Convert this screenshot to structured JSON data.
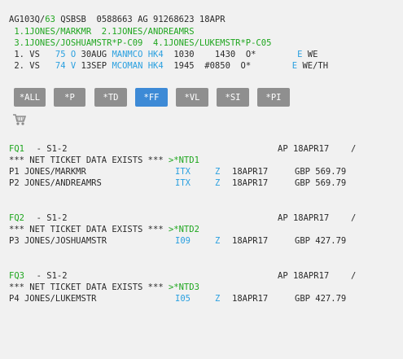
{
  "header": {
    "record_prefix": "AG103Q/",
    "record_num": "63",
    "record_rest": " QSBSB  0588663 AG 91268623 18APR"
  },
  "passengers_row1": " 1.1JONES/MARKMR  2.1JONES/ANDREAMRS",
  "passengers_row2": " 3.1JONES/JOSHUAMSTR*P-C09  4.1JONES/LUKEMSTR*P-C05",
  "segments": [
    {
      "seq": " 1. VS",
      "flight": "   75 O",
      "date": " 30AUG",
      "route": "MANMCO",
      "status": "HK4",
      "dep": "  1030",
      "arr": "    1430",
      "misc": "  O*",
      "e": "E",
      "days": "WE"
    },
    {
      "seq": " 2. VS",
      "flight": "   74 V",
      "date": " 13SEP",
      "route": "MCOMAN",
      "status": "HK4",
      "dep": "  1945",
      "arr": "  #0850",
      "misc": "  O*",
      "e": "E",
      "days": "WE/TH"
    }
  ],
  "buttons": [
    "*ALL",
    "*P",
    "*TD",
    "*FF",
    "*VL",
    "*SI",
    "*PI"
  ],
  "active_button": "*FF",
  "fares": [
    {
      "fq": "FQ1",
      "seg": "  - S1-2",
      "ap": "AP 18APR17",
      "slash": "/",
      "net_text": "*** NET TICKET DATA EXISTS *** ",
      "net_link": ">*NTD1",
      "rows": [
        {
          "pax": "P1 JONES/MARKMR",
          "code": "ITX",
          "z": "Z",
          "date": "18APR17",
          "amount": "GBP 569.79"
        },
        {
          "pax": "P2 JONES/ANDREAMRS",
          "code": "ITX",
          "z": "Z",
          "date": "18APR17",
          "amount": "GBP 569.79"
        }
      ]
    },
    {
      "fq": "FQ2",
      "seg": "  - S1-2",
      "ap": "AP 18APR17",
      "slash": "/",
      "net_text": "*** NET TICKET DATA EXISTS *** ",
      "net_link": ">*NTD2",
      "rows": [
        {
          "pax": "P3 JONES/JOSHUAMSTR",
          "code": "I09",
          "z": "Z",
          "date": "18APR17",
          "amount": "GBP 427.79"
        }
      ]
    },
    {
      "fq": "FQ3",
      "seg": "  - S1-2",
      "ap": "AP 18APR17",
      "slash": "/",
      "net_text": "*** NET TICKET DATA EXISTS *** ",
      "net_link": ">*NTD3",
      "rows": [
        {
          "pax": "P4 JONES/LUKEMSTR",
          "code": "I05",
          "z": "Z",
          "date": "18APR17",
          "amount": "GBP 427.79"
        }
      ]
    }
  ],
  "icons": {
    "cart": "shopping-cart-icon"
  },
  "colors": {
    "green": "#1ea61e",
    "blue": "#2aa0e0",
    "button": "#8f8f8f",
    "button_active": "#3d8ad6"
  }
}
